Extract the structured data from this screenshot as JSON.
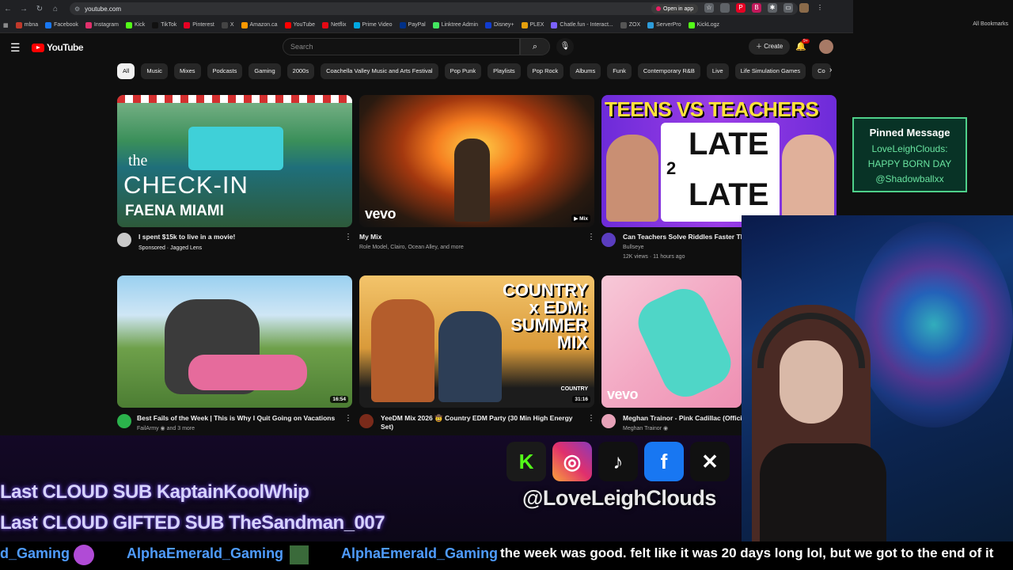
{
  "browser": {
    "url": "youtube.com",
    "open_in_app": "Open in app",
    "all_bookmarks": "All Bookmarks",
    "bookmarks": [
      {
        "label": "mbna",
        "color": "#c0392b"
      },
      {
        "label": "Facebook",
        "color": "#1877f2"
      },
      {
        "label": "Instagram",
        "color": "#e1306c"
      },
      {
        "label": "Kick",
        "color": "#53fc18"
      },
      {
        "label": "TikTok",
        "color": "#111111"
      },
      {
        "label": "Pinterest",
        "color": "#e60023"
      },
      {
        "label": "X",
        "color": "#444444"
      },
      {
        "label": "Amazon.ca",
        "color": "#ff9900"
      },
      {
        "label": "YouTube",
        "color": "#ff0000"
      },
      {
        "label": "Netflix",
        "color": "#e50914"
      },
      {
        "label": "Prime Video",
        "color": "#00a8e1"
      },
      {
        "label": "PayPal",
        "color": "#003087"
      },
      {
        "label": "Linktree Admin",
        "color": "#43e660"
      },
      {
        "label": "Disney+",
        "color": "#113ccf"
      },
      {
        "label": "PLEX",
        "color": "#e5a00d"
      },
      {
        "label": "Chatle.fun - Interact...",
        "color": "#7b61ff"
      },
      {
        "label": "ZOX",
        "color": "#555555"
      },
      {
        "label": "ServerPro",
        "color": "#2d9cdb"
      },
      {
        "label": "KickLogz",
        "color": "#53fc18"
      }
    ]
  },
  "youtube": {
    "logo_text": "YouTube",
    "search_placeholder": "Search",
    "create_label": "Create",
    "notif_badge": "9+",
    "chips": [
      "All",
      "Music",
      "Mixes",
      "Podcasts",
      "Gaming",
      "2000s",
      "Coachella Valley Music and Arts Festival",
      "Pop Punk",
      "Playlists",
      "Pop Rock",
      "Albums",
      "Funk",
      "Contemporary R&B",
      "Live",
      "Life Simulation Games",
      "Co"
    ],
    "videos": [
      {
        "title": "I spent $15k to live in a movie!",
        "meta1": "Sponsored · Jagged Lens",
        "meta2": "",
        "thumb_text_1": "the",
        "thumb_text_2": "CHECK-IN",
        "thumb_text_3": "FAENA MIAMI"
      },
      {
        "title": "My Mix",
        "meta1": "Role Model, Clairo, Ocean Alley, and more",
        "meta2": "",
        "badge": "Mix",
        "vevo": "vevo"
      },
      {
        "title": "Can Teachers Solve Riddles Faster Th",
        "meta1": "Bullseye",
        "meta2": "12K views · 11 hours ago",
        "thumb_text_1": "TEENS VS TEACHERS",
        "thumb_text_2": "LATE",
        "thumb_text_3": "LATE",
        "thumb_num": "2"
      },
      {
        "title": "Best Fails of the Week | This is Why I Quit Going on Vacations",
        "meta1": "FailArmy ◉ and 3 more",
        "meta2": "",
        "duration": "16:54"
      },
      {
        "title": "YeeDM Mix 2026 🤠 Country EDM Party (30 Min High Energy",
        "title2": "Set)",
        "meta1": "",
        "meta2": "",
        "duration": "31:16",
        "thumb_text_1": "COUNTRY",
        "thumb_text_2": "x EDM:",
        "thumb_text_3": "SUMMER",
        "thumb_text_4": "MIX",
        "thumb_small": "COUNTRY"
      },
      {
        "title": "Meghan Trainor - Pink Cadillac (Offici",
        "meta1": "Meghan Trainor ◉",
        "meta2": "",
        "vevo": "vevo"
      }
    ]
  },
  "overlay": {
    "pinned_header": "Pinned Message",
    "pinned_line1": "LoveLeighClouds:",
    "pinned_line2": "HAPPY BORN DAY",
    "pinned_line3": "@Shadowballxx",
    "handle": "@LoveLeighClouds",
    "sub_line_1": "Last CLOUD SUB KaptainKoolWhip",
    "sub_line_2": "Last CLOUD GIFTED SUB TheSandman_007",
    "chat": {
      "frag_name": "d_Gaming",
      "name2": "AlphaEmerald_Gaming",
      "name3": "AlphaEmerald_Gaming",
      "message": "the week was good. felt like it was 20 days long lol, but we got to the end of it"
    },
    "social_icons": [
      "kick-icon",
      "instagram-icon",
      "tiktok-icon",
      "facebook-icon",
      "x-icon"
    ]
  }
}
